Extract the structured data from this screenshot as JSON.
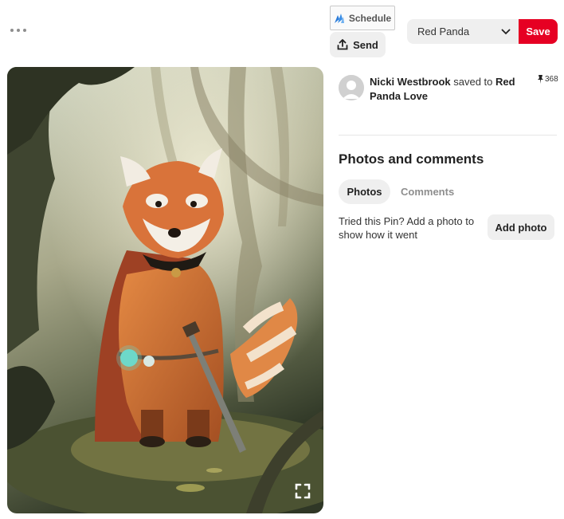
{
  "toolbar": {
    "more_icon": "ellipsis-icon",
    "schedule_label": "Schedule",
    "schedule_icon": "schedule-icon",
    "send_label": "Send",
    "send_icon": "share-icon",
    "board_select_value": "Red Panda",
    "save_label": "Save",
    "save_color": "#e60023"
  },
  "pin": {
    "image_subject": "red panda adventurer illustration",
    "expand_icon": "expand-icon"
  },
  "attribution": {
    "user": "Nicki Westbrook",
    "action": " saved to ",
    "board": "Red Panda Love",
    "repin_count": "368",
    "repin_icon": "pin-icon"
  },
  "comments": {
    "title": "Photos and comments",
    "tabs": [
      {
        "label": "Photos",
        "active": true
      },
      {
        "label": "Comments",
        "active": false
      }
    ],
    "prompt": "Tried this Pin? Add a photo to show how it went",
    "add_photo_label": "Add photo"
  }
}
